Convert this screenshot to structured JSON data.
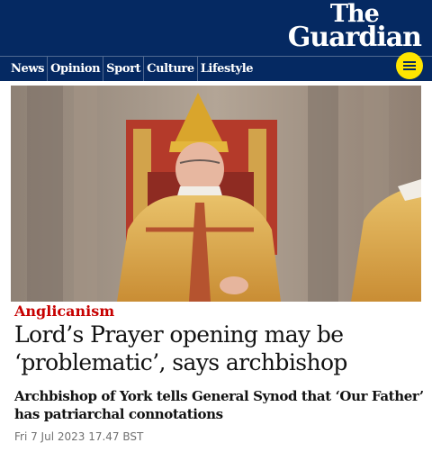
{
  "brand": {
    "line1": "The",
    "line2": "Guardian"
  },
  "nav": {
    "items": [
      "News",
      "Opinion",
      "Sport",
      "Culture",
      "Lifestyle"
    ]
  },
  "menu": {
    "icon": "hamburger-menu-icon"
  },
  "article": {
    "kicker": "Anglicanism",
    "headline": "Lord’s Prayer opening may be ‘problematic’, says archbishop",
    "standfirst": "Archbishop of York tells General Synod that ‘Our Father’ has patriarchal connotations",
    "dateline": "Fri 7 Jul 2023 17.47 BST"
  },
  "colors": {
    "masthead": "#052962",
    "menu_button": "#ffe500",
    "kicker": "#c70000",
    "text": "#121212",
    "dateline": "#707070"
  }
}
